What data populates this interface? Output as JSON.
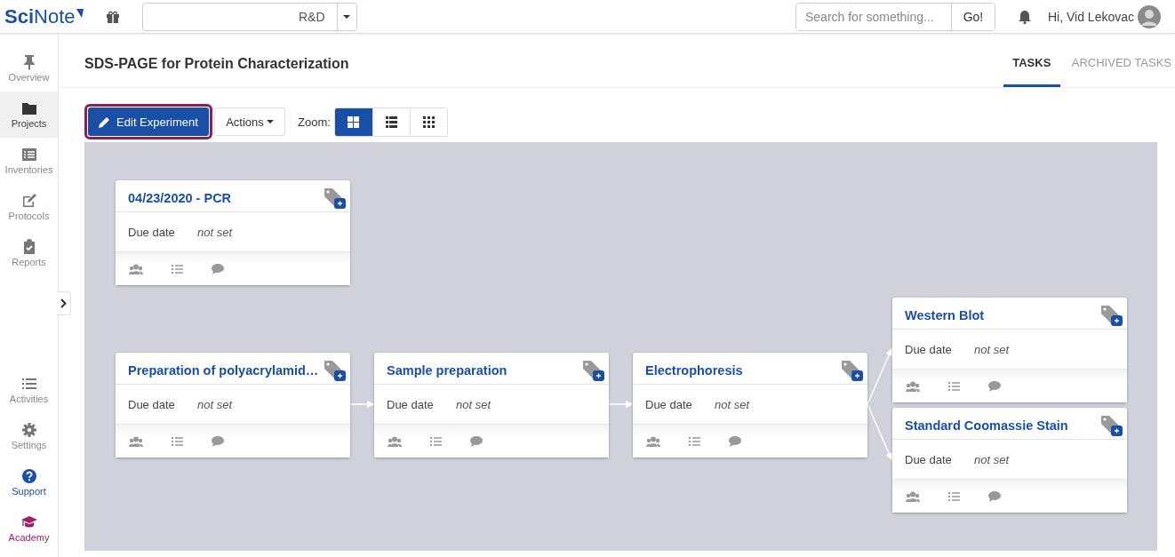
{
  "header": {
    "logo": {
      "part1": "Sci",
      "part2": "Note"
    },
    "team": "R&D",
    "search": {
      "placeholder": "Search for something...",
      "button": "Go!"
    },
    "greeting": "Hi, Vid Lekovac"
  },
  "sidebar": {
    "items": [
      {
        "label": "Overview",
        "kind": "pin",
        "selected": false
      },
      {
        "label": "Projects",
        "kind": "folder",
        "selected": true
      },
      {
        "label": "Inventories",
        "kind": "list",
        "selected": false
      },
      {
        "label": "Protocols",
        "kind": "edit",
        "selected": false
      },
      {
        "label": "Reports",
        "kind": "clipboard",
        "selected": false
      }
    ],
    "bottom_items": [
      {
        "label": "Activities",
        "kind": "activities"
      },
      {
        "label": "Settings",
        "kind": "gear"
      },
      {
        "label": "Support",
        "kind": "help",
        "color": "#1a4fa8"
      },
      {
        "label": "Academy",
        "kind": "cap",
        "color": "#9c1f6b"
      }
    ]
  },
  "page": {
    "title": "SDS-PAGE for Protein Characterization",
    "tabs": [
      {
        "label": "TASKS",
        "selected": true
      },
      {
        "label": "ARCHIVED TASKS",
        "selected": false
      }
    ]
  },
  "toolbar": {
    "edit_button": {
      "label": "Edit Experiment",
      "highlighted": true
    },
    "actions": "Actions",
    "zoom_label": "Zoom:",
    "zoom_options": [
      {
        "kind": "cards",
        "selected": true
      },
      {
        "kind": "list",
        "selected": false
      },
      {
        "kind": "grid",
        "selected": false
      }
    ]
  },
  "tasks": [
    {
      "title": "04/23/2020 - PCR",
      "due_label": "Due date",
      "due_value": "not set"
    },
    {
      "title": "Preparation of polyacrylamid…",
      "due_label": "Due date",
      "due_value": "not set"
    },
    {
      "title": "Sample preparation",
      "due_label": "Due date",
      "due_value": "not set"
    },
    {
      "title": "Electrophoresis",
      "due_label": "Due date",
      "due_value": "not set"
    },
    {
      "title": "Western Blot",
      "due_label": "Due date",
      "due_value": "not set"
    },
    {
      "title": "Standard Coomassie Stain",
      "due_label": "Due date",
      "due_value": "not set"
    }
  ]
}
